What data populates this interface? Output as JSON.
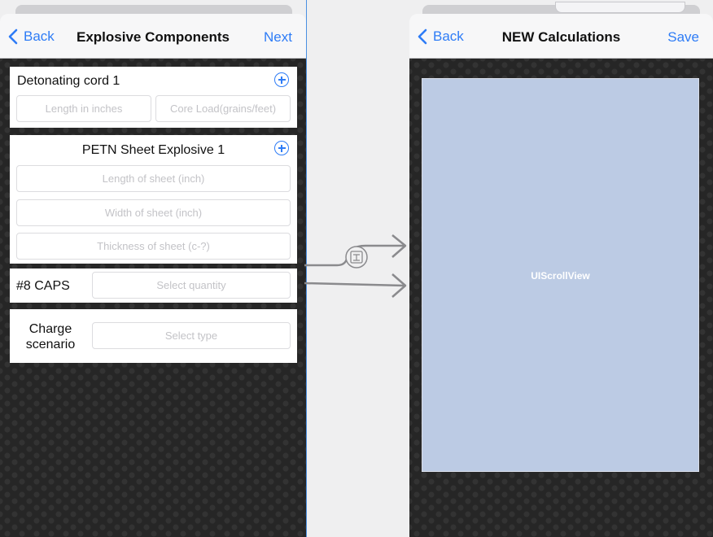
{
  "left_scene": {
    "nav": {
      "back": "Back",
      "title": "Explosive Components",
      "action": "Next"
    },
    "detonating_cord": {
      "title": "Detonating cord 1",
      "length_placeholder": "Length in inches",
      "core_load_placeholder": "Core Load(grains/feet)"
    },
    "petn_sheet": {
      "title": "PETN Sheet Explosive 1",
      "length_placeholder": "Length of sheet (inch)",
      "width_placeholder": "Width of sheet (inch)",
      "thickness_placeholder": "Thickness of sheet (c-?)"
    },
    "caps": {
      "label": "#8 CAPS",
      "placeholder": "Select quantity"
    },
    "charge": {
      "label_line1": "Charge",
      "label_line2": "scenario",
      "placeholder": "Select type"
    }
  },
  "right_scene": {
    "nav": {
      "back": "Back",
      "title": "NEW Calculations",
      "action": "Save"
    },
    "scrollview_label": "UIScrollView"
  },
  "colors": {
    "accent": "#2e7cf6",
    "scrollview": "#bccbe4",
    "background": "#262626"
  },
  "icons": [
    "chevron-left-icon",
    "plus-circle-icon",
    "segue-icon",
    "arrow-right-icon"
  ]
}
